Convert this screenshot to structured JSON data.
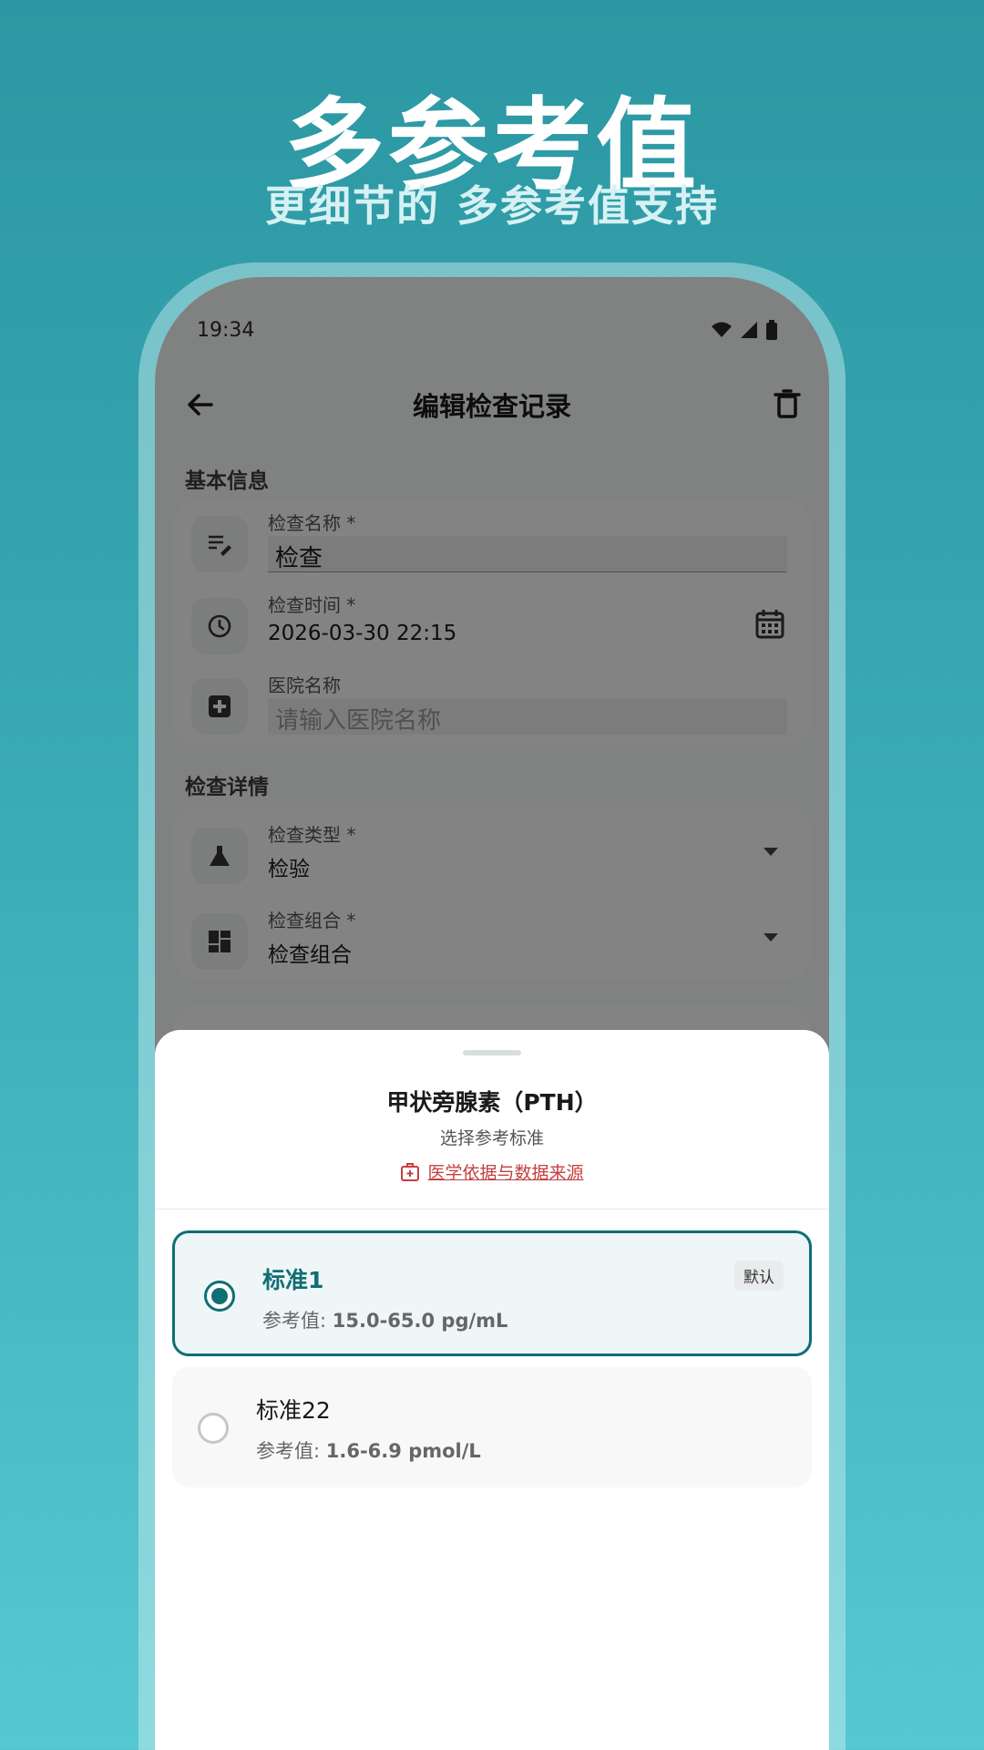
{
  "hero": {
    "title": "多参考值",
    "subtitle": "更细节的 多参考值支持"
  },
  "status_bar": {
    "time": "19:34",
    "icons": [
      "wifi-icon",
      "signal-icon",
      "battery-icon"
    ]
  },
  "app_bar": {
    "title": "编辑检查记录",
    "back_icon": "arrow-left-icon",
    "delete_icon": "trash-icon"
  },
  "basic_info": {
    "section_label": "基本信息",
    "exam_name": {
      "label": "检查名称 *",
      "value": "检查",
      "icon": "edit-notes-icon"
    },
    "exam_time": {
      "label": "检查时间 *",
      "value": "2026-03-30 22:15",
      "icon": "clock-icon",
      "trailing_icon": "calendar-icon"
    },
    "hospital": {
      "label": "医院名称",
      "placeholder": "请输入医院名称",
      "icon": "hospital-icon"
    }
  },
  "exam_details": {
    "section_label": "检查详情",
    "exam_type": {
      "label": "检查类型 *",
      "value": "检验",
      "icon": "flask-icon"
    },
    "exam_group": {
      "label": "检查组合 *",
      "value": "检查组合",
      "icon": "dashboard-icon"
    }
  },
  "sheet": {
    "title": "甲状旁腺素（PTH）",
    "subtitle": "选择参考标准",
    "link_text": "医学依据与数据来源",
    "link_icon": "medical-bag-icon",
    "ref_prefix": "参考值: ",
    "options": [
      {
        "name": "标准1",
        "ref": "15.0-65.0 pg/mL",
        "badge": "默认",
        "selected": true
      },
      {
        "name": "标准22",
        "ref": "1.6-6.9 pmol/L",
        "badge": "",
        "selected": false
      }
    ]
  },
  "colors": {
    "accent": "#106e75",
    "link": "#c53f3f",
    "background_top": "#2b97a2",
    "background_bottom": "#55c8d1"
  }
}
